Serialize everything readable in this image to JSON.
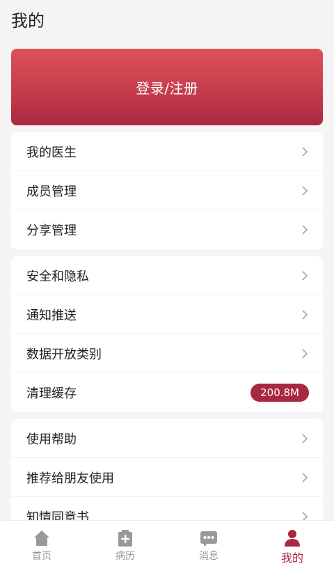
{
  "header": {
    "title": "我的"
  },
  "login": {
    "label": "登录/注册"
  },
  "groups": [
    {
      "items": [
        {
          "label": "我的医生"
        },
        {
          "label": "成员管理"
        },
        {
          "label": "分享管理"
        }
      ]
    },
    {
      "items": [
        {
          "label": "安全和隐私"
        },
        {
          "label": "通知推送"
        },
        {
          "label": "数据开放类别"
        },
        {
          "label": "清理缓存",
          "badge": "200.8M"
        }
      ]
    },
    {
      "items": [
        {
          "label": "使用帮助"
        },
        {
          "label": "推荐给朋友使用"
        },
        {
          "label": "知情同意书"
        }
      ]
    }
  ],
  "tabbar": [
    {
      "label": "首页",
      "icon": "home-icon",
      "active": false
    },
    {
      "label": "病历",
      "icon": "medical-record-icon",
      "active": false
    },
    {
      "label": "消息",
      "icon": "message-icon",
      "active": false
    },
    {
      "label": "我的",
      "icon": "user-icon",
      "active": true
    }
  ],
  "colors": {
    "accent": "#a8283f",
    "gradient_top": "#e05058",
    "inactive": "#999999"
  }
}
